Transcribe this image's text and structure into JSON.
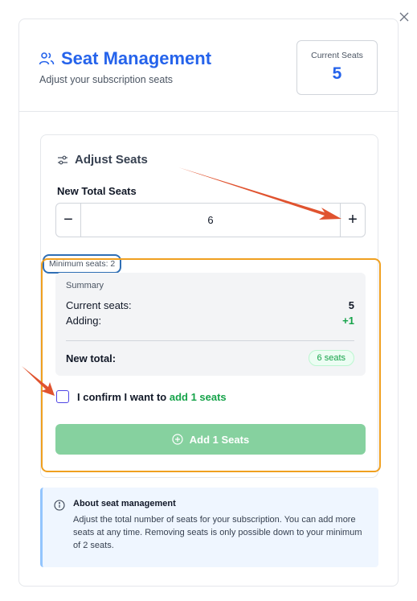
{
  "header": {
    "title": "Seat Management",
    "subtitle": "Adjust your subscription seats",
    "current_seats_label": "Current Seats",
    "current_seats_value": "5"
  },
  "adjust": {
    "section_title": "Adjust Seats",
    "field_label": "New Total Seats",
    "value": "6",
    "minus": "−",
    "plus": "+",
    "minimum_hint": "Minimum seats: 2"
  },
  "summary": {
    "title": "Summary",
    "current_label": "Current seats:",
    "current_value": "5",
    "adding_label": "Adding:",
    "adding_value": "+1",
    "total_label": "New total:",
    "total_badge": "6 seats"
  },
  "confirm": {
    "prefix": "I confirm I want to ",
    "action": "add 1 seats"
  },
  "add_button": {
    "label": "Add 1 Seats"
  },
  "info": {
    "title": "About seat management",
    "body": "Adjust the total number of seats for your subscription. You can add more seats at any time. Removing seats is only possible down to your minimum of 2 seats."
  },
  "colors": {
    "accent": "#2563eb",
    "success": "#16a34a",
    "annotation_frame": "#f0a020",
    "annotation_hint": "#2f6fb5",
    "annotation_arrow": "#e0532f"
  },
  "icons": [
    "close-icon",
    "users-icon",
    "sliders-icon",
    "plus-circle-icon",
    "info-icon"
  ]
}
